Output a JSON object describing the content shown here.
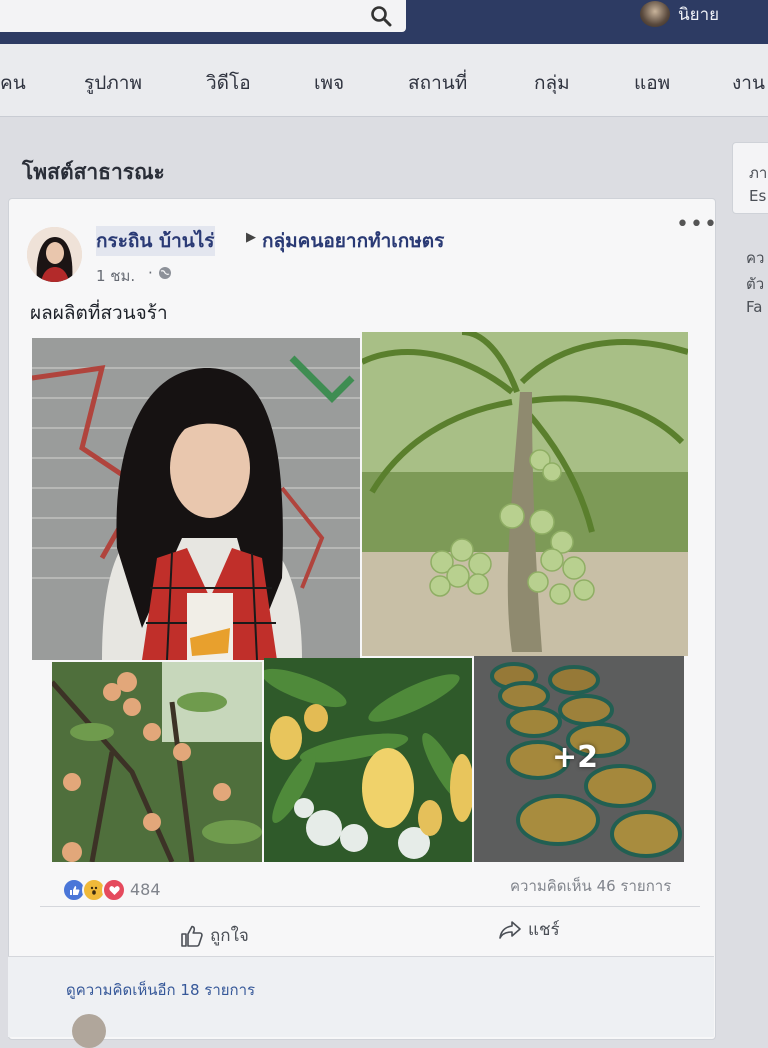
{
  "header": {
    "search_placeholder": "",
    "profile_name": "นิยาย"
  },
  "nav": {
    "items": [
      "คน",
      "รูปภาพ",
      "วิดีโอ",
      "เพจ",
      "สถานที่",
      "กลุ่ม",
      "แอพ",
      "งาน"
    ]
  },
  "section_title": "โพสต์สาธารณะ",
  "side": {
    "card_line1": "ภา",
    "card_line2": "Es",
    "line1": "คว",
    "line2": "ตัว",
    "line3": "Fa"
  },
  "post": {
    "poster_name": "กระถิน บ้านไร่",
    "group_name": "กลุ่มคนอยากทำเกษตร",
    "time": "1 ชม.",
    "dot": "·",
    "text": "ผลผลิตที่สวนจร้า",
    "more_photos": "+2",
    "reaction_count": "484",
    "comment_count": "ความคิดเห็น 46 รายการ",
    "like_label": "ถูกใจ",
    "share_label": "แชร์",
    "view_more_comments": "ดูความคิดเห็นอีก 18 รายการ"
  },
  "colors": {
    "topbar": "#2d3b63",
    "link": "#2a3a75",
    "like": "#4a76d8",
    "love": "#e54a5d",
    "wow": "#f0b93a"
  }
}
